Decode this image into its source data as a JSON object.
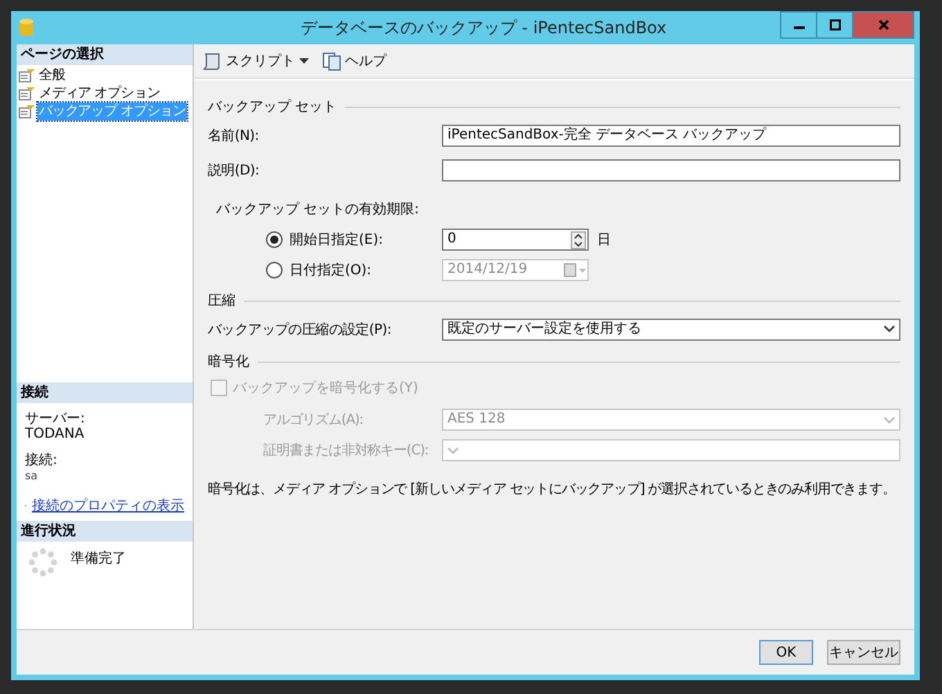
{
  "window": {
    "title": "データベースのバックアップ - iPentecSandBox"
  },
  "sidebar": {
    "heading": "ページの選択",
    "pages": [
      {
        "label": "全般",
        "selected": false
      },
      {
        "label": "メディア オプション",
        "selected": false
      },
      {
        "label": "バックアップ オプション",
        "selected": true
      }
    ],
    "connection": {
      "heading": "接続",
      "server_label": "サーバー:",
      "server": "TODANA",
      "login_label": "接続:",
      "login": "sa",
      "link": "接続のプロパティの表示"
    },
    "progress": {
      "heading": "進行状況",
      "status": "準備完了"
    }
  },
  "toolbar": [
    {
      "kind": "dropdown",
      "label": "スクリプト"
    },
    {
      "kind": "plain",
      "label": "ヘルプ"
    }
  ],
  "backup_set": {
    "heading": "バックアップ セット",
    "name_label": "名前(N):",
    "name": "iPentecSandBox-完全 データベース バックアップ",
    "description_label": "説明(D):",
    "expiry_label": "バックアップ セットの有効期限:",
    "expiry_options": [
      {
        "label": "開始日指定(E):",
        "selected": true,
        "value": "0",
        "unit": "日",
        "kind": "spin"
      },
      {
        "label": "日付指定(O):",
        "selected": false,
        "value": "2014/12/19",
        "kind": "date"
      }
    ]
  },
  "compression": {
    "heading": "圧縮",
    "label": "バックアップの圧縮の設定(P):",
    "value": "既定のサーバー設定を使用する"
  },
  "encryption": {
    "heading": "暗号化",
    "checkbox": {
      "label": "バックアップを暗号化する(Y)",
      "checked": false,
      "disabled": true
    },
    "algorithm_label": "アルゴリズム(A):",
    "algorithm": "AES 128",
    "key_label": "証明書または非対称キー(C):",
    "note": "暗号化は、メディア オプションで [新しいメディア セットにバックアップ] が選択されているときのみ利用できます。"
  },
  "buttons": [
    "OK",
    "キャンセル"
  ]
}
